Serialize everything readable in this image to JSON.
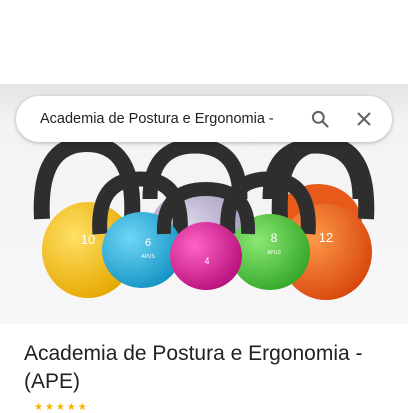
{
  "search": {
    "query": "Academia de Postura e Ergonomia -"
  },
  "hero": {
    "kettlebells": [
      {
        "label": "10",
        "color": "#f5c316",
        "brand": ""
      },
      {
        "label": "6",
        "color": "#25b4e0",
        "brand": "APUS"
      },
      {
        "label": "4",
        "color": "#e0189b",
        "brand": ""
      },
      {
        "label": "8",
        "color": "#4ec83c",
        "brand": "APUS"
      },
      {
        "label": "12",
        "color": "#f0601c",
        "brand": ""
      }
    ]
  },
  "place": {
    "title": "Academia de Postura e Ergonomia - (APE)"
  },
  "colors": {
    "accent_star": "#f4b400"
  }
}
